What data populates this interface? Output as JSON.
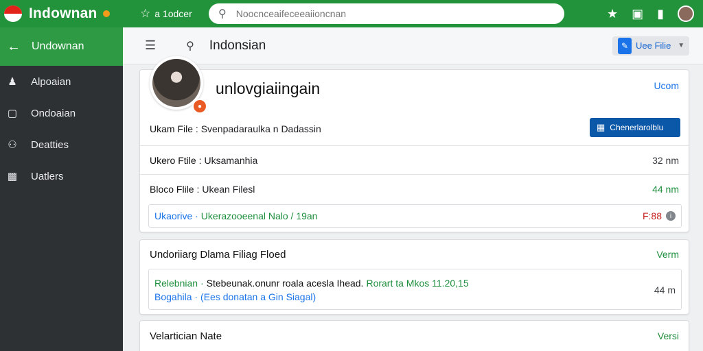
{
  "app": {
    "name": "Indownan"
  },
  "topbar": {
    "star_label": "a 1odcer",
    "search_placeholder": "Noocnceaifeceeaiioncnan",
    "icons": [
      "star-icon",
      "bag-icon",
      "device-icon",
      "avatar"
    ]
  },
  "sidebar": {
    "header_label": "Undownan",
    "items": [
      {
        "icon": "person-icon",
        "label": "Alpoaian"
      },
      {
        "icon": "box-icon",
        "label": "Ondoaian"
      },
      {
        "icon": "people-icon",
        "label": "Deatties"
      },
      {
        "icon": "clipboard-icon",
        "label": "Uatlers"
      }
    ]
  },
  "header": {
    "title": "Indonsian",
    "use_button_label": "Uee Filie"
  },
  "profile_card": {
    "title": "unlovgiaiingain",
    "link": "Ucom",
    "meta_key": "Ukam File :",
    "meta_value": "Svenpadaraulka n Dadassin",
    "action_label": "Chenerlarolblu",
    "rows": [
      {
        "key": "Ukero Ftile :",
        "value": "Uksamanhia",
        "right": "32 nm"
      },
      {
        "key": "Bloco Flile :",
        "value": "Ukean Filesl",
        "right": "44 nm"
      },
      {
        "key": "Ukaorive ·",
        "value": "Ukerazooeenal Nalo / 19an",
        "right": "F:88"
      }
    ]
  },
  "files_card": {
    "title": "Undoriiarg Dlama Filiag Floed",
    "right": "Verm",
    "line1": {
      "key": "Relebnian ·",
      "text": "Stebeunak.onunr roala acesla Ihead.",
      "highlight": "Rorart ta Mkos 11.20,15"
    },
    "line2": {
      "key": "Bogahila ·",
      "text": "(Ees donatan a Gin Siagal)"
    },
    "size": "44 m"
  },
  "note_card": {
    "title": "Velartician Nate",
    "right": "Versi"
  }
}
